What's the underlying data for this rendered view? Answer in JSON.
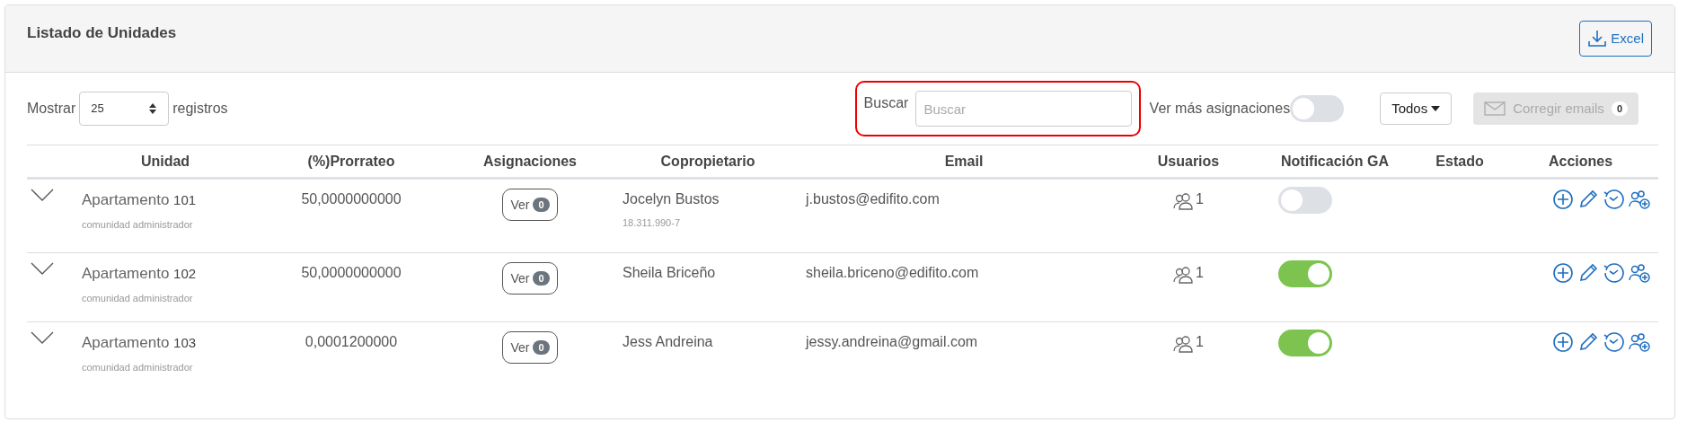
{
  "card": {
    "title_prefix": "Listado de",
    "title_main": "Unidades",
    "export_button": "Excel"
  },
  "toolbar": {
    "show_label": "Mostrar",
    "page_size": "25",
    "records_label": "registros",
    "search_label": "Buscar",
    "search_placeholder": "Buscar",
    "more_assignments_label": "Ver más asignaciones",
    "more_assignments_on": false,
    "filter_dropdown": "Todos",
    "fix_emails_button": "Corregir emails",
    "fix_emails_count": "0",
    "fix_emails_disabled": true
  },
  "table": {
    "columns": [
      "Unidad",
      "(%)Prorrateo",
      "Asignaciones",
      "Copropietario",
      "Email",
      "Usuarios",
      "Notificación GA",
      "Estado",
      "Acciones"
    ],
    "rows": [
      {
        "unit_type": "Apartamento",
        "unit_number": "101",
        "unit_note": "comunidad administrador",
        "prorrateo": "50,0000000000",
        "assign_button": "Ver",
        "assign_count": "0",
        "owner": "Jocelyn Bustos",
        "owner_id": "18.311.990-7",
        "email": "j.bustos@edifito.com",
        "users": "1",
        "notification_on": false
      },
      {
        "unit_type": "Apartamento",
        "unit_number": "102",
        "unit_note": "comunidad administrador",
        "prorrateo": "50,0000000000",
        "assign_button": "Ver",
        "assign_count": "0",
        "owner": "Sheila Briceño",
        "email": "sheila.briceno@edifito.com",
        "users": "1",
        "notification_on": true
      },
      {
        "unit_type": "Apartamento",
        "unit_number": "103",
        "unit_note": "comunidad administrador",
        "prorrateo": "0,0001200000",
        "assign_button": "Ver",
        "assign_count": "0",
        "owner": "Jess Andreina",
        "email": "jessy.andreina@gmail.com",
        "users": "1",
        "notification_on": true
      }
    ]
  }
}
